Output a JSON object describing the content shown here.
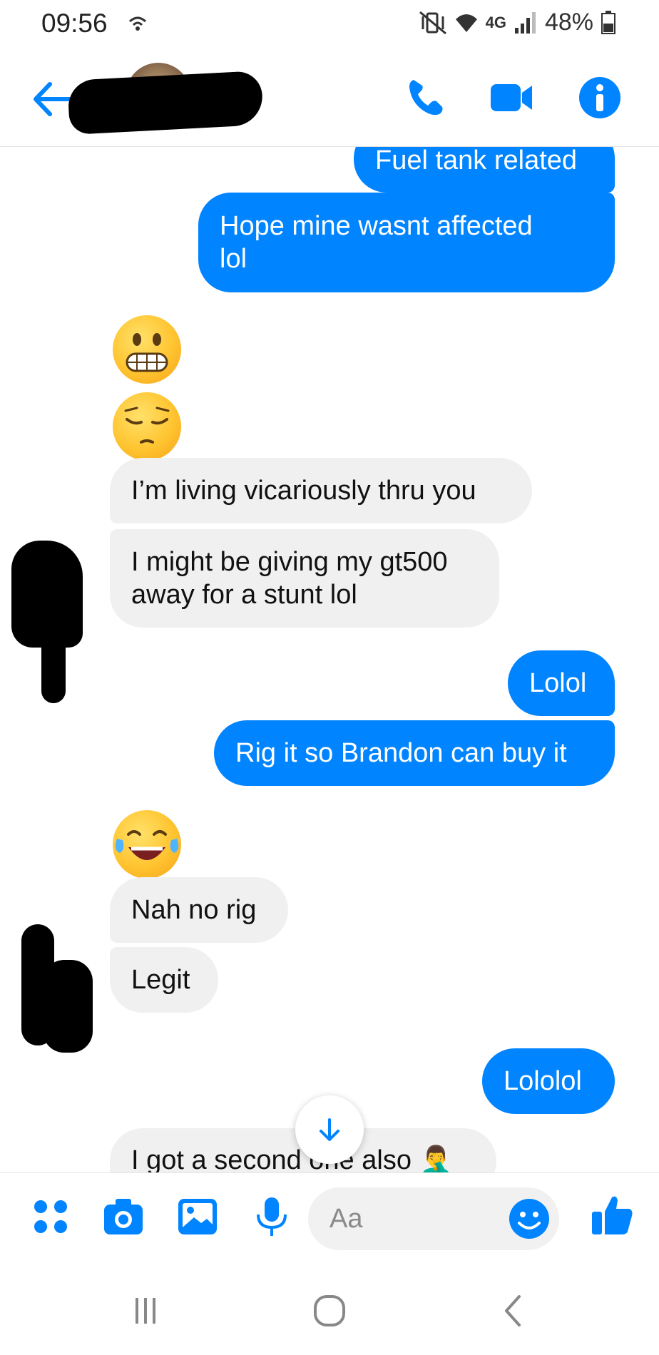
{
  "status_bar": {
    "time": "09:56",
    "network": "4G",
    "battery": "48%"
  },
  "header": {
    "back_icon": "arrow-left-icon",
    "actions": [
      "phone-icon",
      "video-icon",
      "info-icon"
    ]
  },
  "messages": [
    {
      "sender": "me",
      "text": "Fuel tank related"
    },
    {
      "sender": "me",
      "text": "Hope mine wasnt affected lol"
    },
    {
      "sender": "them",
      "type": "emoji",
      "emoji": "grimacing-face"
    },
    {
      "sender": "them",
      "type": "emoji",
      "emoji": "pensive-face"
    },
    {
      "sender": "them",
      "text": "I’m living vicariously thru you"
    },
    {
      "sender": "them",
      "text": "I might be giving my gt500 away for a stunt lol"
    },
    {
      "sender": "me",
      "text": "Lolol"
    },
    {
      "sender": "me",
      "text": "Rig it so Brandon can buy it"
    },
    {
      "sender": "them",
      "type": "emoji",
      "emoji": "face-with-tears-of-joy"
    },
    {
      "sender": "them",
      "text": "Nah no rig"
    },
    {
      "sender": "them",
      "text": "Legit"
    },
    {
      "sender": "me",
      "text": "Lololol"
    },
    {
      "sender": "them",
      "text": "I got a second one also 🤦‍♂️"
    }
  ],
  "composer": {
    "placeholder": "Aa",
    "icons": [
      "apps-icon",
      "camera-icon",
      "gallery-icon",
      "microphone-icon",
      "emoji-icon",
      "thumbs-up-icon"
    ]
  },
  "colors": {
    "accent": "#0084ff",
    "incoming_bubble": "#f0f0f0",
    "outgoing_text": "#ffffff"
  }
}
